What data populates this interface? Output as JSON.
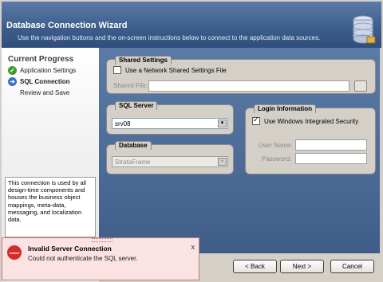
{
  "header": {
    "title": "Database Connection Wizard",
    "subtitle": "Use the navigation buttons and the on-screen instructions below to connect to the application data sources.",
    "logo_icon": "database-icon"
  },
  "progress": {
    "title": "Current Progress",
    "steps": [
      {
        "label": "Application Settings",
        "state": "done",
        "icon": "check-icon"
      },
      {
        "label": "SQL Connection",
        "state": "current",
        "icon": "arrow-right-icon"
      },
      {
        "label": "Review and Save",
        "state": "pending"
      }
    ],
    "info_text": "This connection is used by all design-time components and houses the business object mappings, meta-data, messaging, and localization data."
  },
  "shared_settings": {
    "title": "Shared Settings",
    "use_network_label": "Use a Network Shared Settings File",
    "use_network_checked": false,
    "shared_file_label": "Shared File:",
    "shared_file_value": ""
  },
  "sql_server": {
    "title": "SQL Server",
    "selected": "srv08"
  },
  "database": {
    "title": "Database",
    "selected": "StrataFrame"
  },
  "login": {
    "title": "Login Information",
    "integrated_label": "Use Windows Integrated Security",
    "integrated_checked": true,
    "username_label": "User Name:",
    "username_value": "",
    "password_label": "Password:",
    "password_value": ""
  },
  "nav": {
    "back_label": "< Back",
    "next_label": "Next >",
    "cancel_label": "Cancel"
  },
  "toast": {
    "title": "Invalid Server Connection",
    "message": "Could not authenticate the SQL server.",
    "close_label": "x",
    "icon": "error-icon",
    "accent_color": "#d62b2b"
  }
}
